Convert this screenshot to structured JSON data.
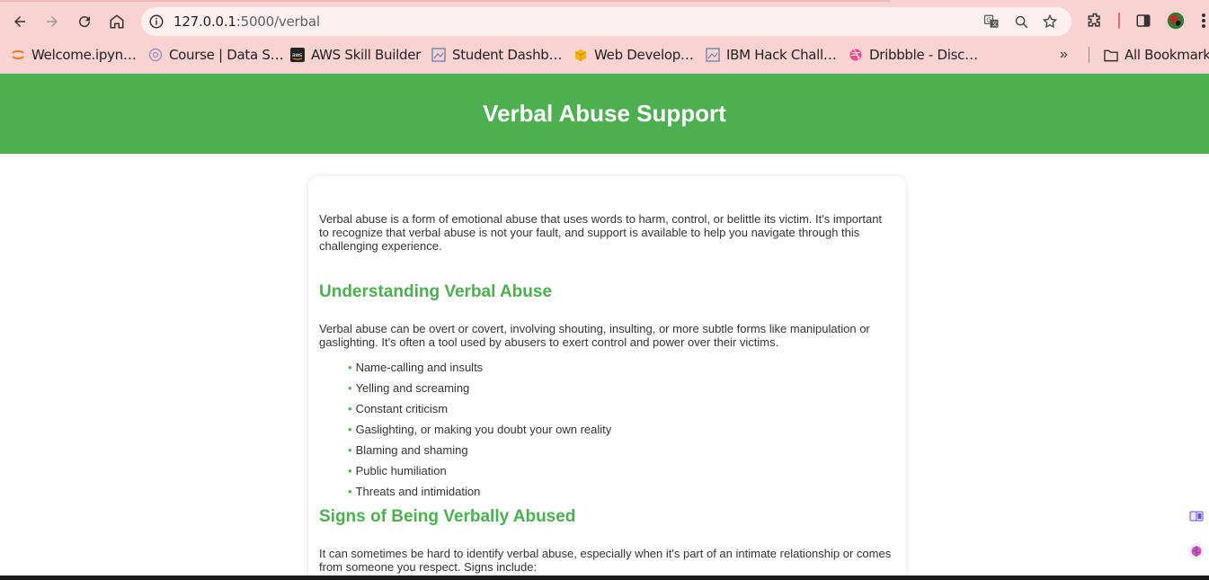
{
  "browser": {
    "url_host": "127.0.0.1",
    "url_path": ":5000/verbal",
    "bookmarks": [
      {
        "label": "Welcome.ipyn…",
        "icon": "jupyter-icon"
      },
      {
        "label": "Course | Data S…",
        "icon": "course-icon"
      },
      {
        "label": "AWS Skill Builder",
        "icon": "aws-icon"
      },
      {
        "label": "Student Dashb…",
        "icon": "broken-image-icon"
      },
      {
        "label": "Web Develop…",
        "icon": "box-icon"
      },
      {
        "label": "IBM Hack Chall…",
        "icon": "broken-image-icon"
      },
      {
        "label": "Dribbble - Disc…",
        "icon": "dribbble-icon"
      }
    ],
    "all_bookmarks": "All Bookmarks",
    "overflow": "»"
  },
  "header": {
    "title": "Verbal Abuse Support",
    "color": "#4caf50"
  },
  "content": {
    "intro": "Verbal abuse is a form of emotional abuse that uses words to harm, control, or belittle its victim. It's important to recognize that verbal abuse is not your fault, and support is available to help you navigate through this challenging experience.",
    "section1": {
      "heading": "Understanding Verbal Abuse",
      "text": "Verbal abuse can be overt or covert, involving shouting, insulting, or more subtle forms like manipulation or gaslighting. It's often a tool used by abusers to exert control and power over their victims.",
      "items": [
        "Name-calling and insults",
        "Yelling and screaming",
        "Constant criticism",
        "Gaslighting, or making you doubt your own reality",
        "Blaming and shaming",
        "Public humiliation",
        "Threats and intimidation"
      ]
    },
    "section2": {
      "heading": "Signs of Being Verbally Abused",
      "text": "It can sometimes be hard to identify verbal abuse, especially when it's part of an intimate relationship or comes from someone you respect. Signs include:"
    }
  }
}
